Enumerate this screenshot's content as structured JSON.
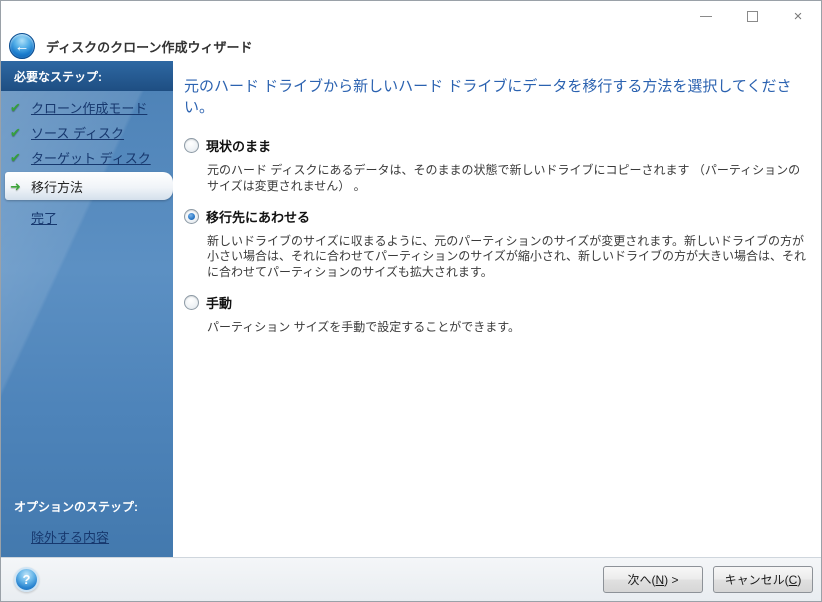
{
  "window": {
    "title": "ディスクのクローン作成ウィザード"
  },
  "icons": {
    "back": "←",
    "check": "✔",
    "current_arrow": "➜",
    "help": "?",
    "close": "×"
  },
  "sidebar": {
    "required_header": "必要なステップ:",
    "steps": [
      {
        "label": "クローン作成モード",
        "state": "done"
      },
      {
        "label": "ソース ディスク",
        "state": "done"
      },
      {
        "label": "ターゲット ディスク",
        "state": "done"
      },
      {
        "label": "移行方法",
        "state": "current"
      },
      {
        "label": "完了",
        "state": "pending"
      }
    ],
    "optional_header": "オプションのステップ:",
    "optional_link": "除外する内容"
  },
  "main": {
    "heading": "元のハード ドライブから新しいハード ドライブにデータを移行する方法を選択してください。",
    "options": [
      {
        "label": "現状のまま",
        "selected": false,
        "description": "元のハード ディスクにあるデータは、そのままの状態で新しいドライブにコピーされます （パーティションのサイズは変更されません） 。"
      },
      {
        "label": "移行先にあわせる",
        "selected": true,
        "description": "新しいドライブのサイズに収まるように、元のパーティションのサイズが変更されます。新しいドライブの方が小さい場合は、それに合わせてパーティションのサイズが縮小され、新しいドライブの方が大きい場合は、それに合わせてパーティションのサイズも拡大されます。"
      },
      {
        "label": "手動",
        "selected": false,
        "description": "パーティション サイズを手動で設定することができます。"
      }
    ]
  },
  "footer": {
    "next_pre": "次へ(",
    "next_mnemonic": "N",
    "next_post": ") >",
    "cancel_pre": "キャンセル(",
    "cancel_mnemonic": "C",
    "cancel_post": ")"
  },
  "colors": {
    "sidebar_blue": "#4c81b6",
    "sidebar_header_navy": "#1e4e82",
    "heading_blue": "#2b62b0",
    "link_navy": "#17386e",
    "check_green": "#35a03c",
    "selected_radio_blue": "#2f7cc9"
  }
}
